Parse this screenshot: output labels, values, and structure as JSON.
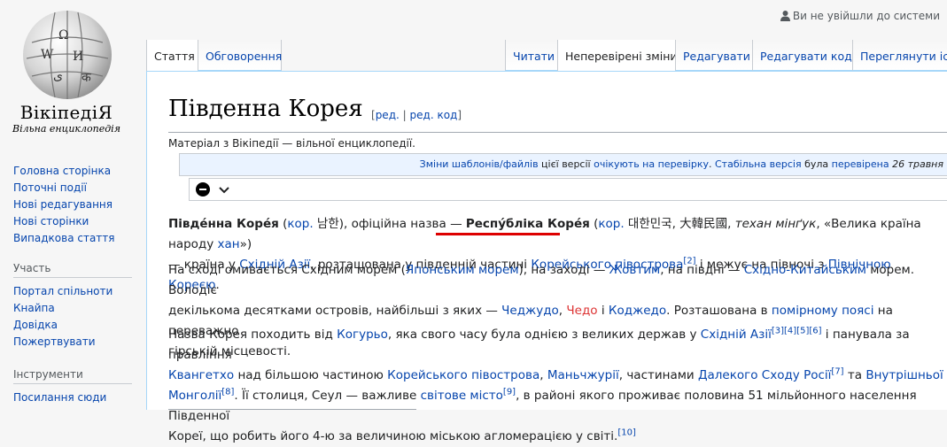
{
  "logo": {
    "name": "ВікіпедіЯ",
    "tagline": "Вільна енциклопедія"
  },
  "personal": {
    "not_logged_in": "Ви не увійшли до системи"
  },
  "nav": {
    "items": [
      "Головна сторінка",
      "Поточні події",
      "Нові редагування",
      "Нові сторінки",
      "Випадкова стаття"
    ]
  },
  "participation": {
    "heading": "Участь",
    "items": [
      "Портал спільноти",
      "Кнайпа",
      "Довідка",
      "Пожертвувати"
    ]
  },
  "tools": {
    "heading": "Інструменти",
    "items": [
      "Посилання сюди"
    ]
  },
  "tabs": {
    "article": "Стаття",
    "talk": "Обговорення",
    "read": "Читати",
    "pending": "Неперевірені зміни",
    "edit": "Редагувати",
    "edit_source": "Редагувати код",
    "history": "Переглянути іст"
  },
  "page": {
    "title": "Південна Корея",
    "edit_link": "ред.",
    "edit_sep": "|",
    "edit_code_link": "ред. код",
    "from": "Матеріал з Вікіпедії — вільної енциклопедії."
  },
  "flagged": {
    "changes": "Зміни шаблонів/файлів",
    "this_version": " цієї версії ",
    "awaiting": "очікують на перевірку",
    "dot": ". ",
    "stable": "Стабільна версія",
    "was": " була ",
    "reviewed": "перевірена",
    "date": " 26 травня"
  },
  "p1": {
    "t1": "Півде́нна Коре́я",
    "t2": " (",
    "kor1": "кор.",
    "t3": " 남한), офіційна назва — ",
    "official": "Респу́бліка Коре́я",
    "t4": " (",
    "kor2": "кор.",
    "t5": " 대한민국, 大韓民國, ",
    "translit": "техан мінґук",
    "t6": ", «Велика країна народу ",
    "han": "хан",
    "t7": "»)",
    "t8": "— країна у ",
    "east_asia": "Східній Азії",
    "t9": ", розташована у південній частині ",
    "peninsula": "Корейського півострова",
    "ref2": "[2]",
    "t10": " і межує на півночі з ",
    "north_korea": "Північною Кореєю",
    "t11": "."
  },
  "p2": {
    "t1": "На сході омивається Східним морем (",
    "japan_sea": "Японським морем",
    "t2": "), на заході — ",
    "yellow": "Жовтим",
    "t3": ", на півдні — ",
    "east_china": "Східно-Китайським",
    "t4": " морем. Володіє",
    "t5": "декількома десятками островів, найбільші з яких — ",
    "jeju": "Чеджудо",
    "t6": ", ",
    "chedo": "Чедо",
    "t7": " і ",
    "geoje": "Коджедо",
    "t8": ". Розташована в ",
    "temperate": "помірному поясі",
    "t9": " на переважно",
    "t10": "гірській місцевості."
  },
  "p3": {
    "t1": "Назва Корея походить від ",
    "goguryeo": "Когурьо",
    "t2": ", яка свого часу була однією з великих держав у ",
    "east_asia": "Східній Азії",
    "refs1": "[3][4][5][6]",
    "t3": " і панувала за правління",
    "gwanggaeto": "Квангетхо",
    "t4": " над більшою частиною ",
    "peninsula": "Корейського півострова",
    "t5": ", ",
    "manchuria": "Маньчжурії",
    "t6": ", частинами ",
    "far_east": "Далекого Сходу Росії",
    "ref7": "[7]",
    "t7": " та ",
    "inner_mongolia": "Внутрішньої",
    "mongolia2": "Монголії",
    "ref8": "[8]",
    "t8": ". Її столиця, Сеул — важливе ",
    "global_city": "світове місто",
    "ref9": "[9]",
    "t9": ", в районі якого проживає половина 51 мільйонного населення Південної",
    "t10": "Кореї, що робить його 4-ю за величиною міською агломерацією у світі.",
    "ref10": "[10]"
  }
}
